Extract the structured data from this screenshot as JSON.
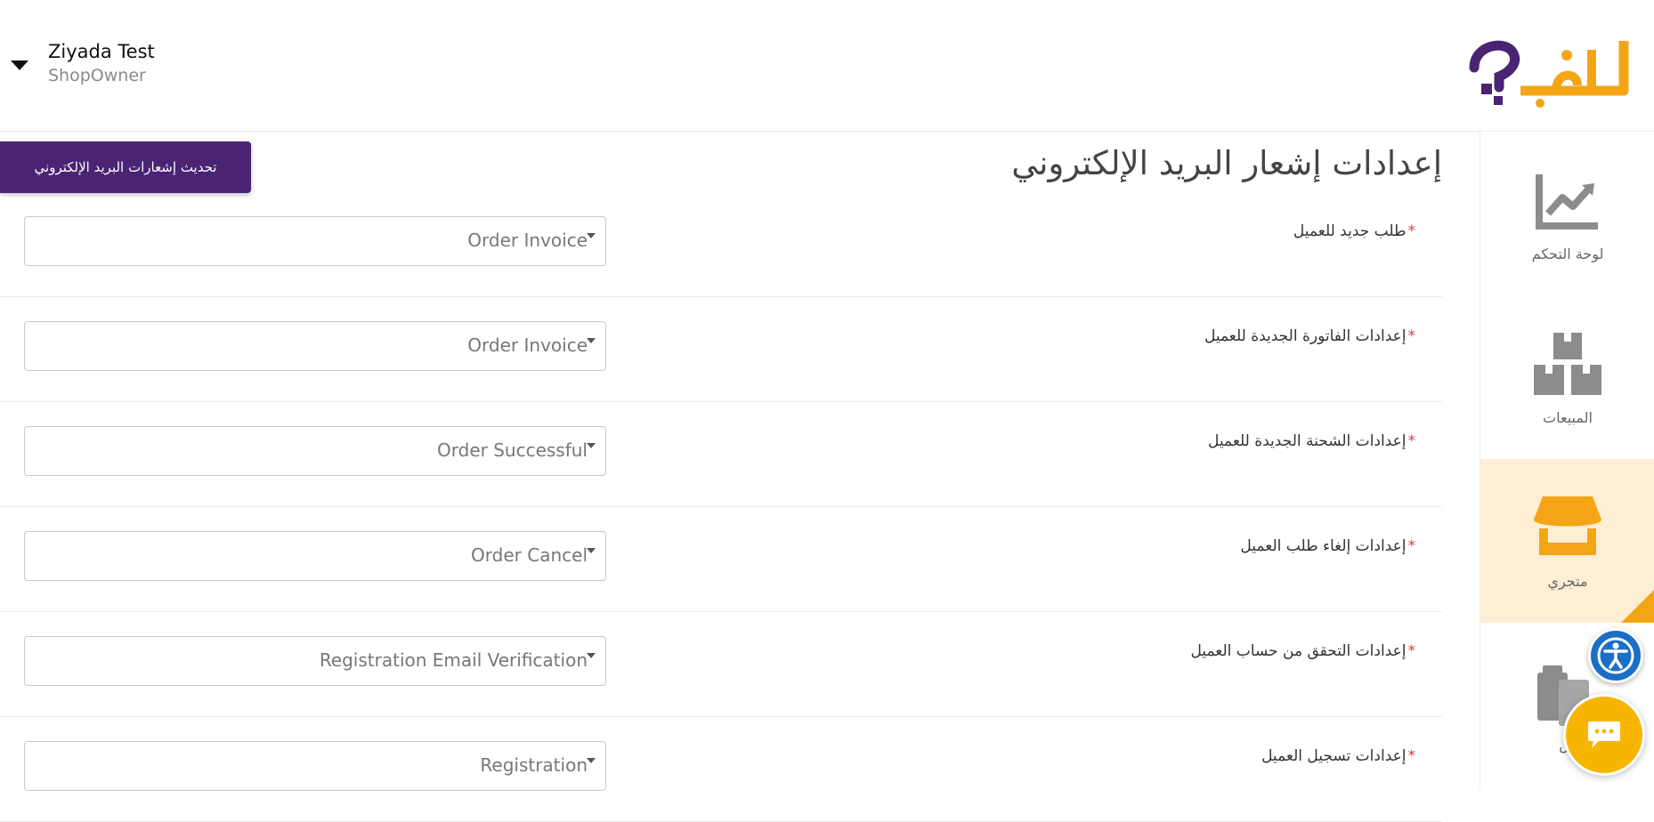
{
  "header": {
    "user_name": "Ziyada Test",
    "user_role": "ShopOwner",
    "brand_color": "#4a2373",
    "accent_color": "#f4a516"
  },
  "sidebar": {
    "items": [
      {
        "label": "لوحة التحكم",
        "icon": "chart-icon",
        "active": false
      },
      {
        "label": "المبيعات",
        "icon": "boxes-icon",
        "active": false
      },
      {
        "label": "متجري",
        "icon": "store-icon",
        "active": true
      },
      {
        "label": "س",
        "icon": "clipboard-icon",
        "active": false
      }
    ]
  },
  "main": {
    "title": "إعدادات إشعار البريد الإلكتروني",
    "update_button_label": "تحديث إشعارات البريد الإلكتروني",
    "rows": [
      {
        "label": "طلب جديد للعميل",
        "value": "Order Invoice"
      },
      {
        "label": "إعدادات الفاتورة الجديدة للعميل",
        "value": "Order Invoice"
      },
      {
        "label": "إعدادات الشحنة الجديدة للعميل",
        "value": "Order Successful"
      },
      {
        "label": "إعدادات إلغاء طلب العميل",
        "value": "Order Cancel"
      },
      {
        "label": "إعدادات التحقق من حساب العميل",
        "value": "Registration Email Verification"
      },
      {
        "label": "إعدادات تسجيل العميل",
        "value": "Registration"
      }
    ],
    "required_marker": "*"
  },
  "widgets": {
    "accessibility_icon": "accessibility-icon",
    "chat_icon": "chat-icon"
  }
}
